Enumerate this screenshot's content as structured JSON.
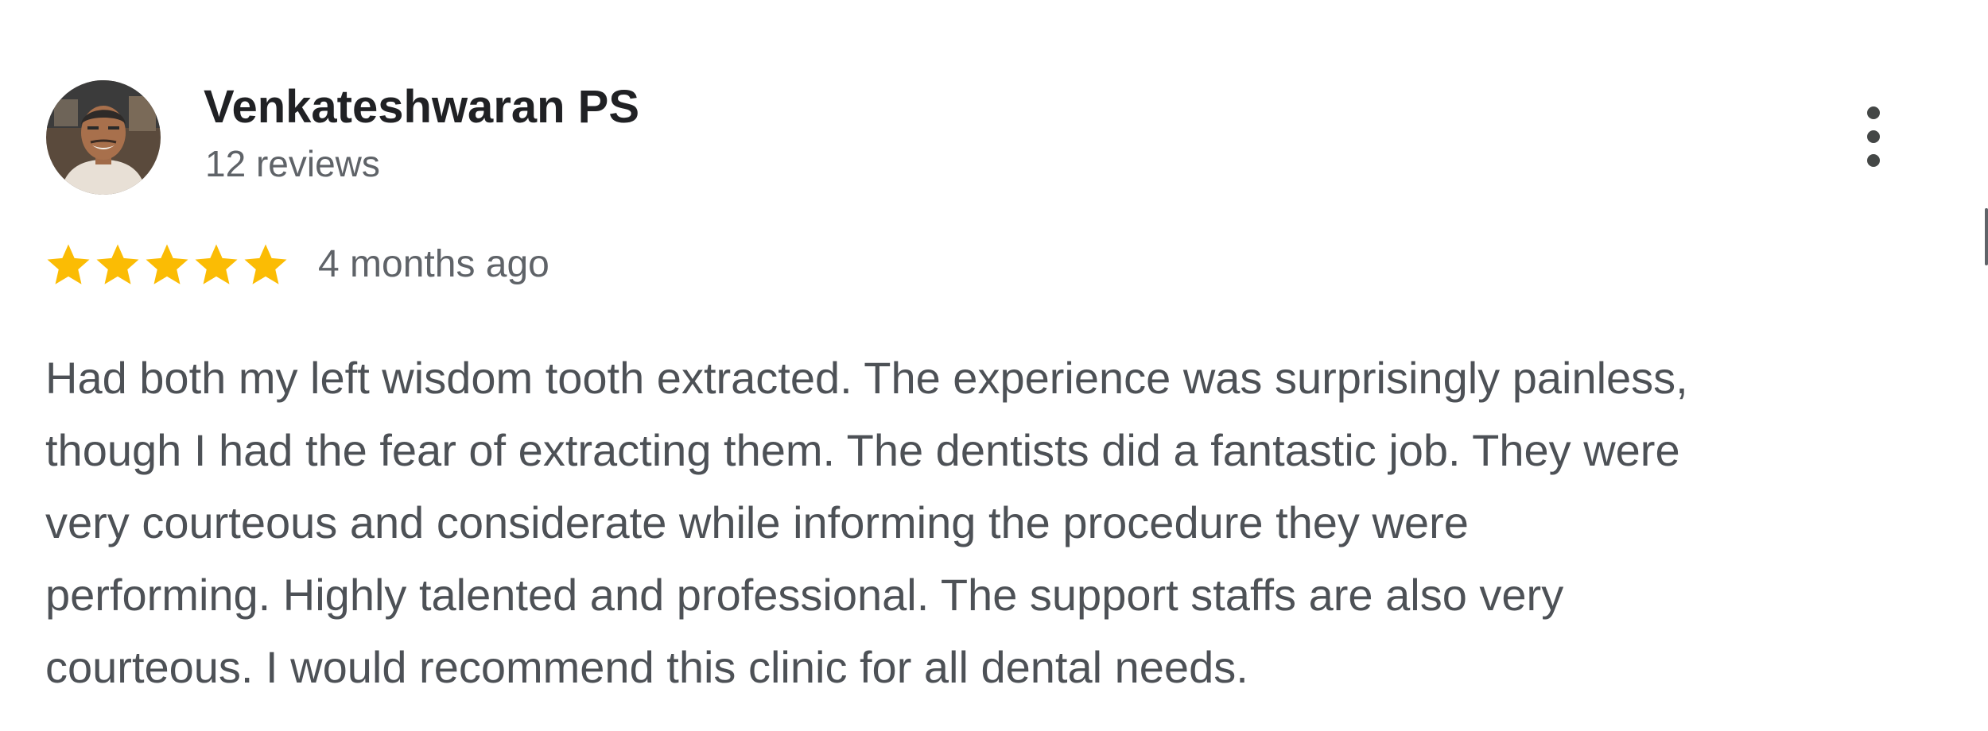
{
  "review": {
    "reviewer_name": "Venkateshwaran PS",
    "review_count": "12 reviews",
    "rating": 5,
    "rating_max": 5,
    "time_ago": "4 months ago",
    "text_lines": [
      "Had both my left wisdom tooth extracted. The experience was surprisingly painless,",
      "though I had the fear of extracting them. The dentists did a fantastic job. They were",
      "very courteous and considerate while informing the procedure they were",
      "performing. Highly talented and professional. The support staffs are also very",
      "courteous. I would recommend this clinic for all dental needs."
    ]
  },
  "icons": {
    "avatar": "avatar-photo",
    "more": "more-vert-icon",
    "star": "star-icon"
  },
  "colors": {
    "star": "#fbbc04",
    "name": "#202124",
    "secondary": "#5f6368",
    "body_text": "#4d5156"
  }
}
